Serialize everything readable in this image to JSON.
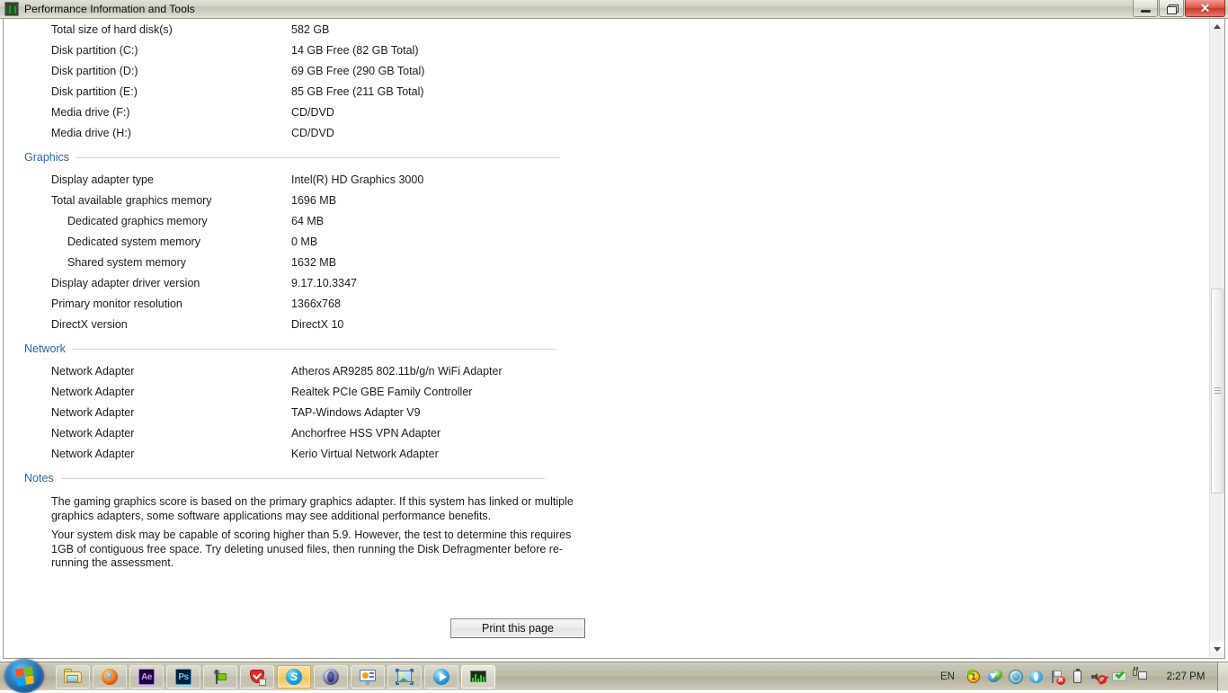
{
  "window": {
    "title": "Performance Information and Tools",
    "icon": "performance-monitor-icon",
    "minimize_label": "Minimize",
    "restore_label": "Restore Down",
    "close_label": "Close",
    "close_glyph": "✕"
  },
  "disk_rows": [
    {
      "label": "Total size of hard disk(s)",
      "value": "582 GB"
    },
    {
      "label": "Disk partition (C:)",
      "value": "14 GB Free (82 GB Total)"
    },
    {
      "label": "Disk partition (D:)",
      "value": "69 GB Free (290 GB Total)"
    },
    {
      "label": "Disk partition (E:)",
      "value": "85 GB Free (211 GB Total)"
    },
    {
      "label": "Media drive (F:)",
      "value": "CD/DVD"
    },
    {
      "label": "Media drive (H:)",
      "value": "CD/DVD"
    }
  ],
  "graphics": {
    "heading": "Graphics",
    "rows": [
      {
        "label": "Display adapter type",
        "value": "Intel(R) HD Graphics 3000",
        "indent": false
      },
      {
        "label": "Total available graphics memory",
        "value": "1696 MB",
        "indent": false
      },
      {
        "label": "Dedicated graphics memory",
        "value": "64 MB",
        "indent": true
      },
      {
        "label": "Dedicated system memory",
        "value": "0 MB",
        "indent": true
      },
      {
        "label": "Shared system memory",
        "value": "1632 MB",
        "indent": true
      },
      {
        "label": "Display adapter driver version",
        "value": "9.17.10.3347",
        "indent": false
      },
      {
        "label": "Primary monitor resolution",
        "value": "1366x768",
        "indent": false
      },
      {
        "label": "DirectX version",
        "value": "DirectX 10",
        "indent": false
      }
    ]
  },
  "network": {
    "heading": "Network",
    "rows": [
      {
        "label": "Network Adapter",
        "value": "Atheros AR9285 802.11b/g/n WiFi Adapter"
      },
      {
        "label": "Network Adapter",
        "value": "Realtek PCIe GBE Family Controller"
      },
      {
        "label": "Network Adapter",
        "value": "TAP-Windows Adapter V9"
      },
      {
        "label": "Network Adapter",
        "value": "Anchorfree HSS VPN Adapter"
      },
      {
        "label": "Network Adapter",
        "value": "Kerio Virtual Network Adapter"
      }
    ]
  },
  "notes": {
    "heading": "Notes",
    "paragraphs": [
      "The gaming graphics score is based on the primary graphics adapter. If this system has linked or multiple graphics adapters, some software applications may see additional performance benefits.",
      "Your system disk may be capable of scoring higher than 5.9. However, the test to determine this requires 1GB of contiguous free space. Try deleting unused files, then running the Disk Defragmenter before re-running the assessment."
    ]
  },
  "print_button": {
    "label": "Print this page"
  },
  "scrollbar": {
    "up_arrow": "scroll-up-arrow",
    "down_arrow": "scroll-down-arrow",
    "thumb": "scroll-thumb"
  },
  "taskbar": {
    "start": "start-orb",
    "buttons": [
      {
        "name": "windows-explorer",
        "icon": "folder-icon",
        "state": "pinned"
      },
      {
        "name": "mozilla-firefox",
        "icon": "firefox-icon",
        "state": "pinned"
      },
      {
        "name": "adobe-after-effects",
        "icon": "after-effects-icon",
        "label": "Ae",
        "state": "pinned"
      },
      {
        "name": "adobe-photoshop",
        "icon": "photoshop-icon",
        "label": "Ps",
        "state": "pinned"
      },
      {
        "name": "filezilla",
        "icon": "filezilla-icon",
        "state": "pinned"
      },
      {
        "name": "security-shield",
        "icon": "shield-icon",
        "state": "pinned"
      },
      {
        "name": "skype",
        "icon": "skype-icon",
        "label": "S",
        "state": "active"
      },
      {
        "name": "opera-browser",
        "icon": "opera-icon",
        "state": "running"
      },
      {
        "name": "presentation-app",
        "icon": "presentation-icon",
        "state": "running"
      },
      {
        "name": "photo-viewer",
        "icon": "picture-icon",
        "state": "running"
      },
      {
        "name": "windows-media-player",
        "icon": "media-player-icon",
        "state": "running"
      },
      {
        "name": "performance-information-and-tools",
        "icon": "performance-monitor-icon",
        "state": "current"
      }
    ],
    "tray": {
      "language": "EN",
      "icons": [
        {
          "name": "notification-badge-icon",
          "badge": "1"
        },
        {
          "name": "download-manager-icon"
        },
        {
          "name": "blue-orb-icon"
        },
        {
          "name": "opera-tray-icon"
        },
        {
          "name": "action-center-flag-icon",
          "badge": "✕"
        },
        {
          "name": "battery-icon"
        },
        {
          "name": "volume-muted-icon"
        },
        {
          "name": "antivirus-check-icon"
        },
        {
          "name": "network-connection-icon"
        }
      ],
      "clock": "2:27 PM",
      "show_desktop": "show-desktop-button"
    }
  }
}
